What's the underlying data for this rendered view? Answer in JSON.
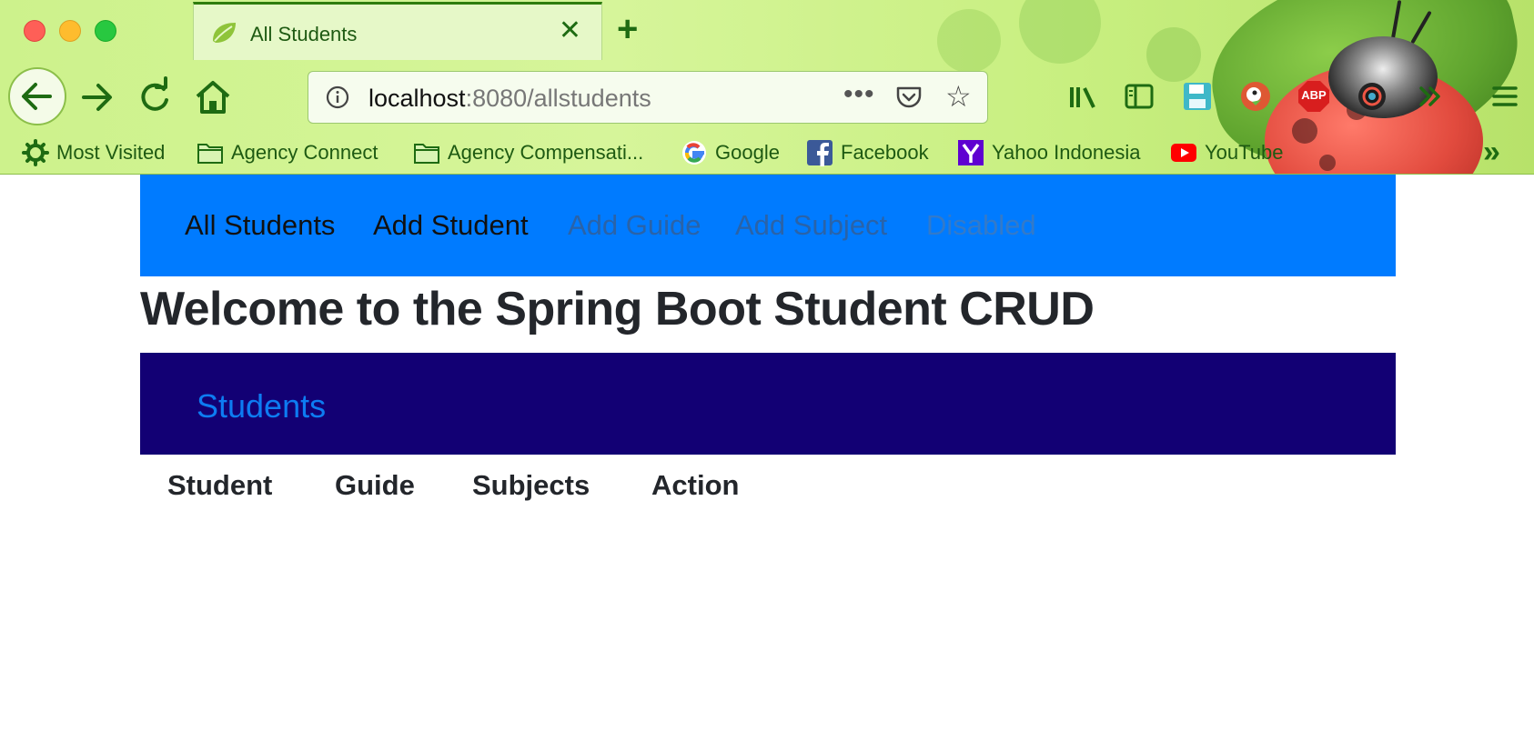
{
  "browser": {
    "tab": {
      "title": "All Students",
      "close_glyph": "✕",
      "favicon": "spring-leaf-icon"
    },
    "new_tab_glyph": "+",
    "url": {
      "host": "localhost",
      "path": ":8080/allstudents",
      "dots": "•••"
    },
    "bookmarks": [
      {
        "label": "Most Visited",
        "icon": "gear-icon"
      },
      {
        "label": "Agency Connect",
        "icon": "folder-icon"
      },
      {
        "label": "Agency Compensati...",
        "icon": "folder-icon"
      },
      {
        "label": "Google",
        "icon": "google-icon"
      },
      {
        "label": "Facebook",
        "icon": "facebook-icon"
      },
      {
        "label": "Yahoo Indonesia",
        "icon": "yahoo-icon"
      },
      {
        "label": "YouTube",
        "icon": "youtube-icon"
      }
    ],
    "more_glyph": "»",
    "abp_label": "ABP",
    "colors": {
      "chrome_green": "#1e6b12",
      "chrome_bg": "#d6f59a"
    }
  },
  "page": {
    "navbar": {
      "links": [
        {
          "label": "All Students",
          "state": "active"
        },
        {
          "label": "Add Student",
          "state": "active"
        },
        {
          "label": "Add Guide",
          "state": "muted"
        },
        {
          "label": "Add Subject",
          "state": "muted"
        },
        {
          "label": "Disabled",
          "state": "disabled"
        }
      ],
      "bg": "#007bff"
    },
    "welcome": "Welcome to the Spring Boot Student CRUD",
    "jumbotron": {
      "title": "Students",
      "bg": "#120074",
      "title_color": "#0d7cf2"
    },
    "table": {
      "headers": [
        "Student",
        "Guide",
        "Subjects",
        "Action"
      ]
    }
  }
}
